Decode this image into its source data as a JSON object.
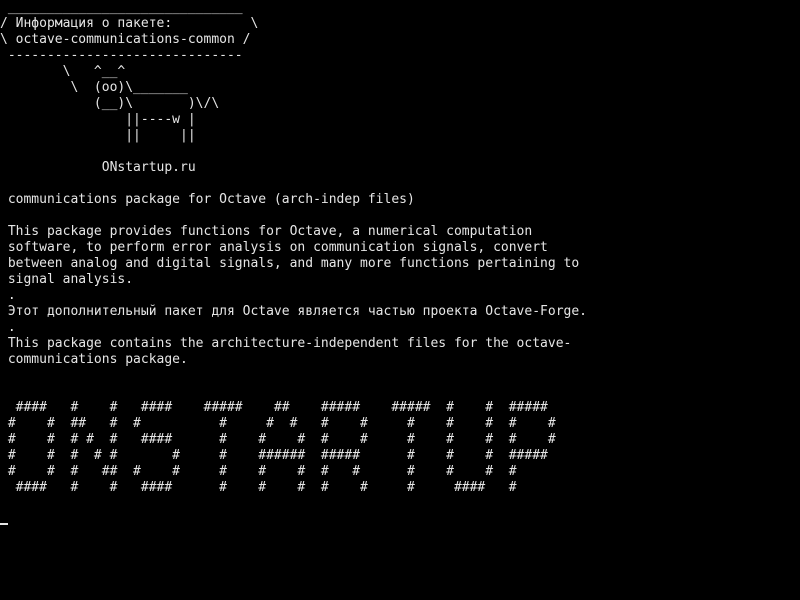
{
  "terminal": {
    "fg_color": "#e6e6e6",
    "bg_color": "#000000",
    "lines": [
      " ______________________________",
      "/ Информация о пакете:          \\",
      "\\ octave-communications-common /",
      " ------------------------------",
      "        \\   ^__^",
      "         \\  (oo)\\_______",
      "            (__)\\       )\\/\\",
      "                ||----w |",
      "                ||     ||",
      "",
      "             ONstartup.ru",
      "",
      " communications package for Octave (arch-indep files)",
      "",
      " This package provides functions for Octave, a numerical computation",
      " software, to perform error analysis on communication signals, convert",
      " between analog and digital signals, and many more functions pertaining to",
      " signal analysis.",
      " .",
      " Этот дополнительный пакет для Octave является частью проекта Octave-Forge.",
      " .",
      " This package contains the architecture-independent files for the octave-",
      " communications package.",
      "",
      "",
      "  ####   #    #   ####    #####    ##    #####    #####  #    #  #####",
      " #    #  ##   #  #          #     #  #   #    #     #    #    #  #    #",
      " #    #  # #  #   ####      #    #    #  #    #     #    #    #  #    #",
      " #    #  #  # #       #     #    ######  #####      #    #    #  #####",
      " #    #  #   ##  #    #     #    #    #  #   #      #    #    #  #",
      "  ####   #    #   ####      #    #    #  #    #     #     ####   #"
    ]
  }
}
